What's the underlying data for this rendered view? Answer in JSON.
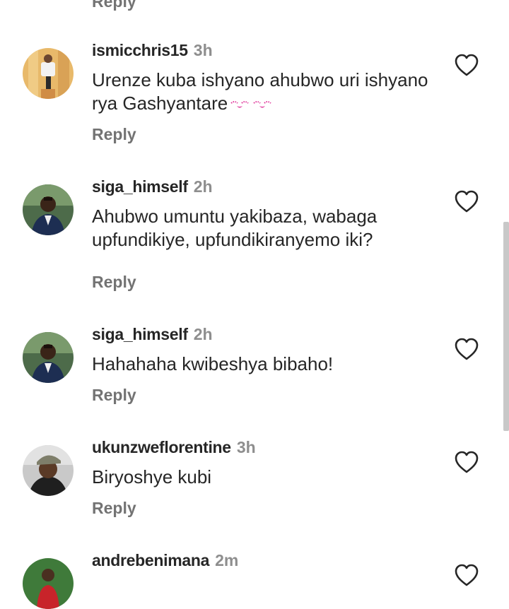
{
  "top_reply_label": "Reply",
  "comments": [
    {
      "username": "ismicchris15",
      "time": "3h",
      "text": "Urenze kuba ishyano ahubwo uri ishyano rya Gashyantare",
      "emoji_icons": [
        "kissing-face-icon",
        "kissing-face-icon"
      ],
      "reply_label": "Reply"
    },
    {
      "username": "siga_himself",
      "time": "2h",
      "text": "Ahubwo umuntu yakibaza, wabaga upfundikiye, upfundikiranyemo iki?",
      "reply_label": "Reply"
    },
    {
      "username": "siga_himself",
      "time": "2h",
      "text": "Hahahaha kwibeshya bibaho!",
      "reply_label": "Reply"
    },
    {
      "username": "ukunzweflorentine",
      "time": "3h",
      "text": "Biryoshye kubi",
      "reply_label": "Reply"
    },
    {
      "username": "andrebenimana",
      "time": "2m"
    }
  ],
  "colors": {
    "username": "#262626",
    "meta_gray": "#8e8e8e",
    "reply_gray": "#737373",
    "emoji_pink": "#e0389c"
  },
  "icons": {
    "like": "heart-outline-icon"
  }
}
